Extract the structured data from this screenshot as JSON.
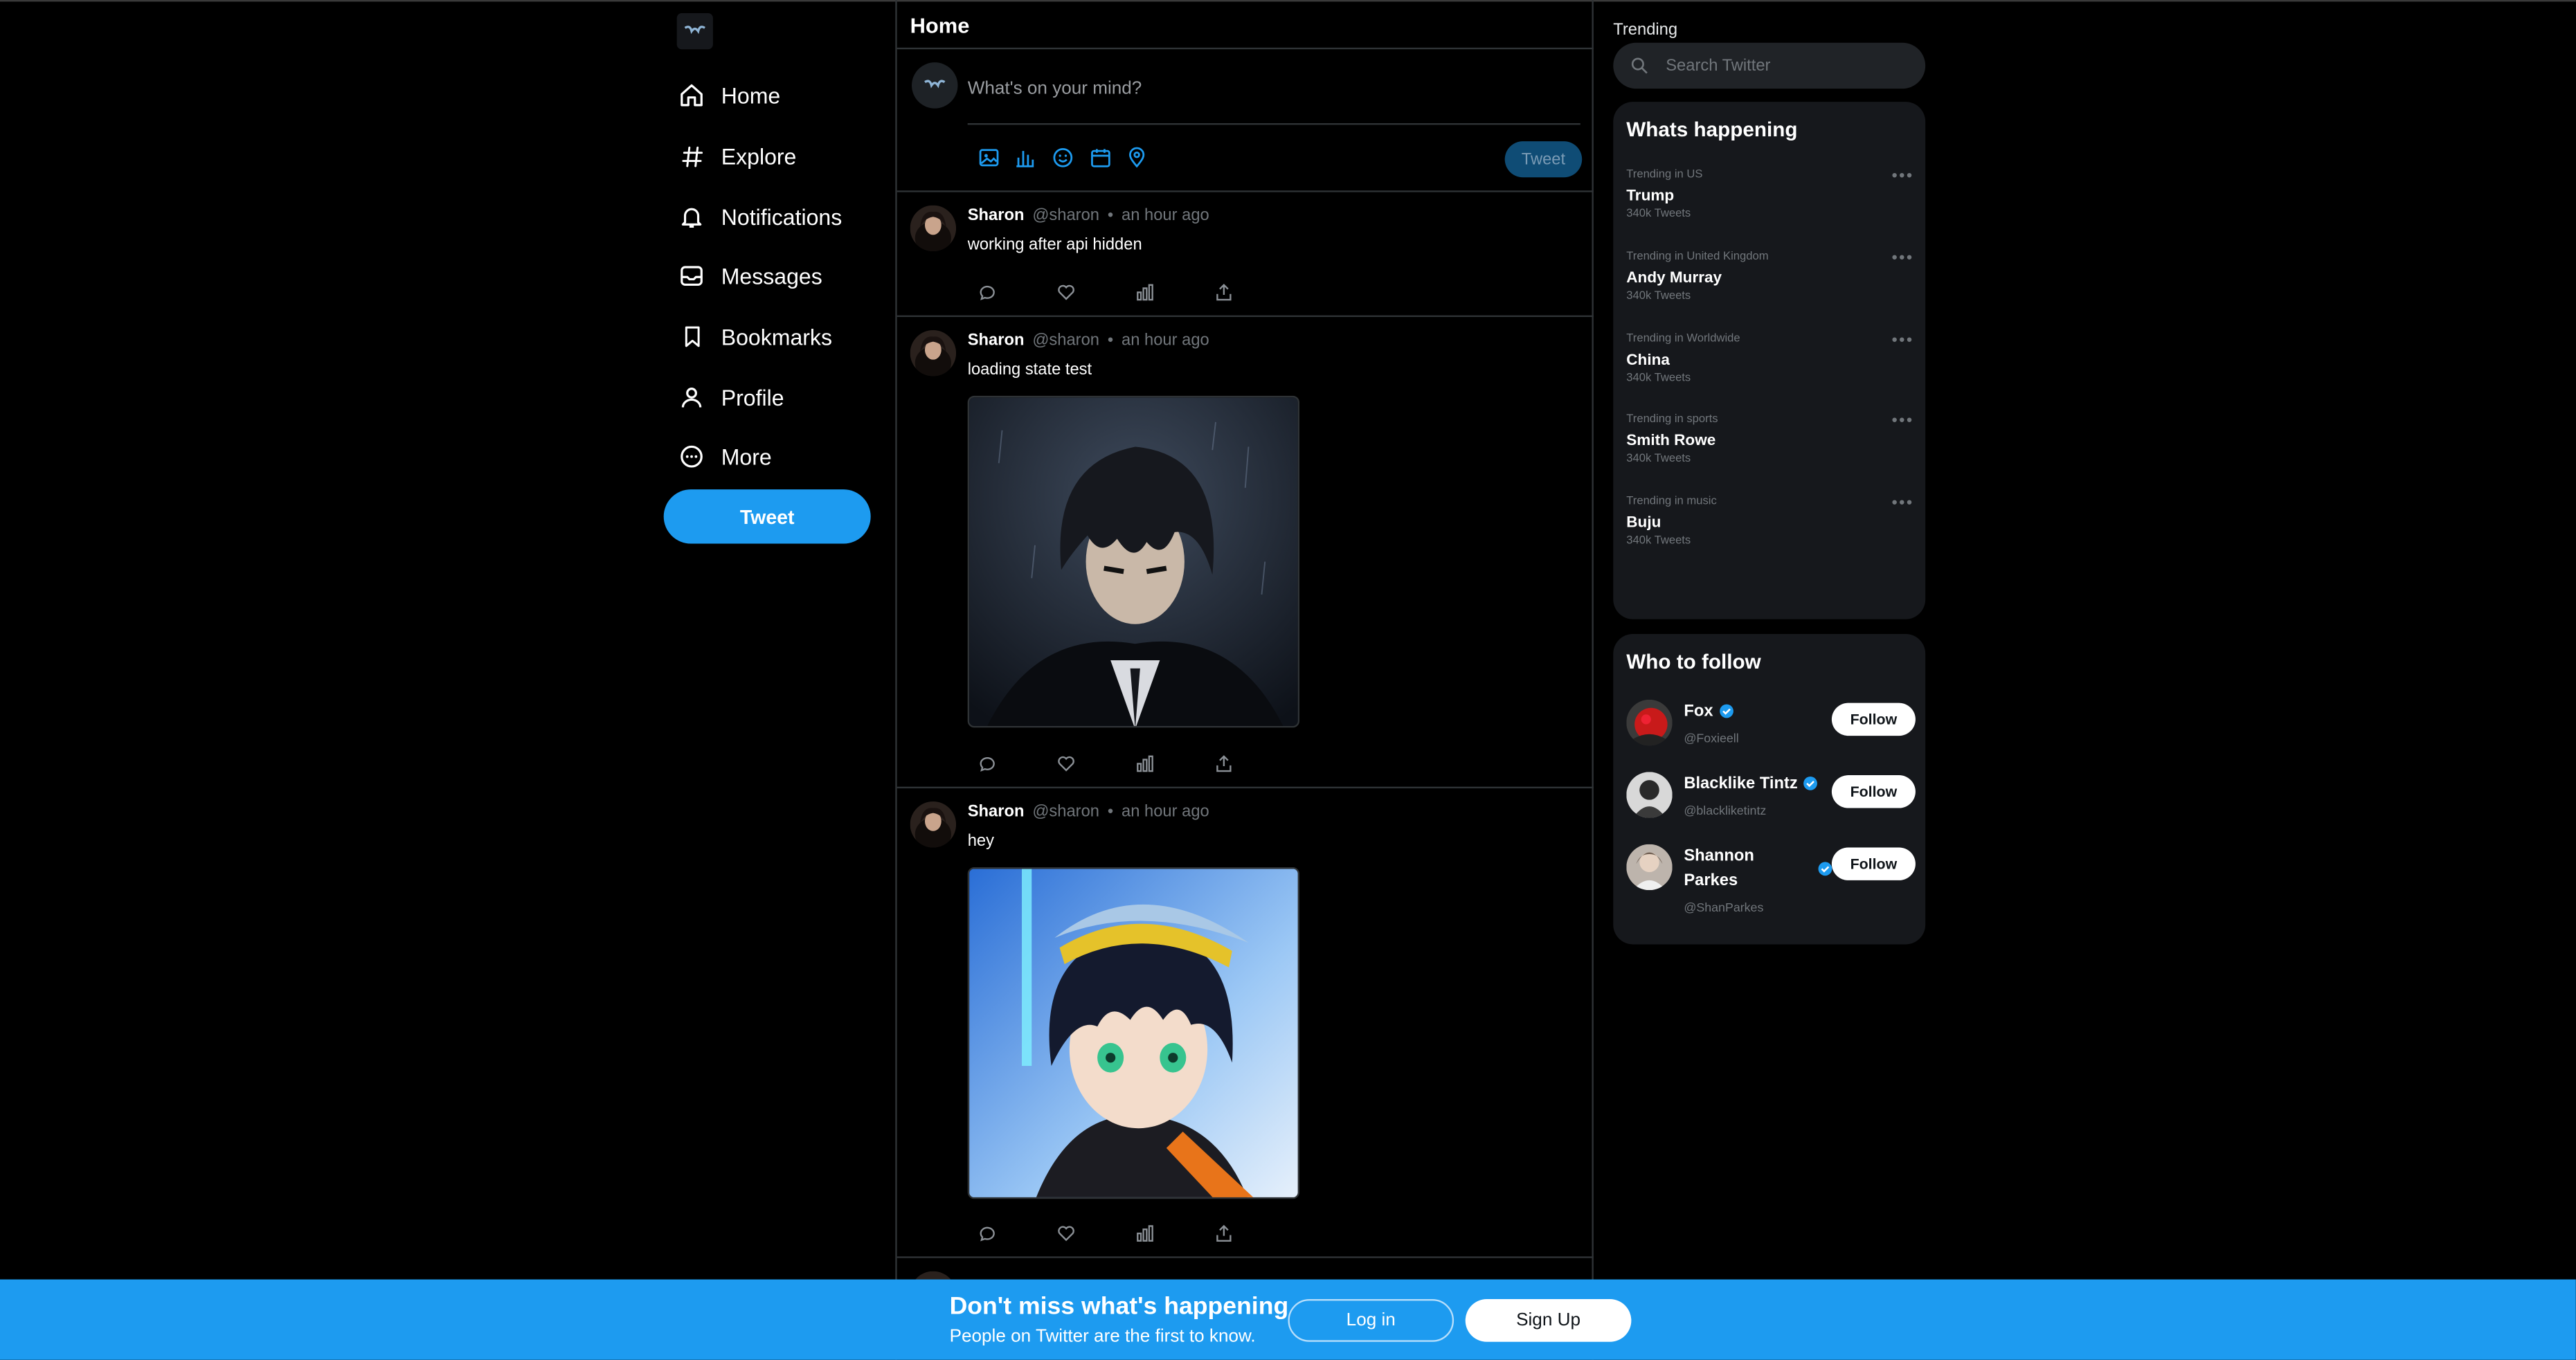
{
  "nav": {
    "items": [
      {
        "label": "Home",
        "icon": "home-icon"
      },
      {
        "label": "Explore",
        "icon": "hashtag-icon"
      },
      {
        "label": "Notifications",
        "icon": "bell-icon"
      },
      {
        "label": "Messages",
        "icon": "inbox-icon"
      },
      {
        "label": "Bookmarks",
        "icon": "bookmark-icon"
      },
      {
        "label": "Profile",
        "icon": "user-icon"
      },
      {
        "label": "More",
        "icon": "more-circle-icon"
      }
    ],
    "tweet_label": "Tweet"
  },
  "feed": {
    "title": "Home",
    "composer": {
      "placeholder": "What's on your mind?",
      "tweet_label": "Tweet"
    },
    "posts": [
      {
        "name": "Sharon",
        "handle": "@sharon",
        "separator": "•",
        "time": "an hour ago",
        "text": "working after api hidden",
        "image": ""
      },
      {
        "name": "Sharon",
        "handle": "@sharon",
        "separator": "•",
        "time": "an hour ago",
        "text": "loading state test",
        "image": "dark-haired anime boy in black suit"
      },
      {
        "name": "Sharon",
        "handle": "@sharon",
        "separator": "•",
        "time": "an hour ago",
        "text": "hey",
        "image": "anime boy with green eyes and blue cap"
      }
    ]
  },
  "sidebar": {
    "trending_label": "Trending",
    "search_placeholder": "Search Twitter",
    "happening_title": "Whats happening",
    "trends": [
      {
        "context": "Trending in US",
        "name": "Trump",
        "count": "340k Tweets"
      },
      {
        "context": "Trending in United Kingdom",
        "name": "Andy Murray",
        "count": "340k Tweets"
      },
      {
        "context": "Trending in Worldwide",
        "name": "China",
        "count": "340k Tweets"
      },
      {
        "context": "Trending in sports",
        "name": "Smith Rowe",
        "count": "340k Tweets"
      },
      {
        "context": "Trending in music",
        "name": "Buju",
        "count": "340k Tweets"
      }
    ],
    "more_glyph": "•••",
    "follow_title": "Who to follow",
    "follow": [
      {
        "name": "Fox",
        "handle": "@Foxieell",
        "button": "Follow"
      },
      {
        "name": "Blacklike Tintz",
        "handle": "@blackliketintz",
        "button": "Follow"
      },
      {
        "name": "Shannon Parkes",
        "handle": "@ShanParkes",
        "button": "Follow"
      }
    ]
  },
  "banner": {
    "title": "Don't miss what's happening",
    "subtitle": "People on Twitter are the first to know.",
    "login": "Log in",
    "signup": "Sign Up"
  },
  "colors": {
    "accent": "#1d9bf0",
    "background": "#000000",
    "panel": "#16181c",
    "muted": "#71767b"
  }
}
